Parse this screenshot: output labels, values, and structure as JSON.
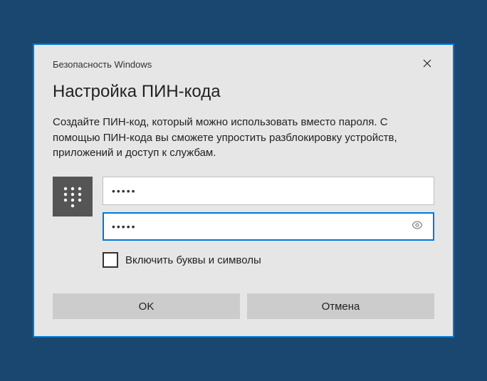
{
  "titlebar": {
    "title": "Безопасность Windows"
  },
  "heading": "Настройка ПИН-кода",
  "description": "Создайте ПИН-код, который можно использовать вместо пароля. С помощью ПИН-кода вы сможете упростить разблокировку устройств, приложений и доступ к службам.",
  "inputs": {
    "pin_value": "•••••",
    "pin_confirm_value": "•••••"
  },
  "checkbox": {
    "label": "Включить буквы и символы",
    "checked": false
  },
  "buttons": {
    "ok": "OK",
    "cancel": "Отмена"
  }
}
